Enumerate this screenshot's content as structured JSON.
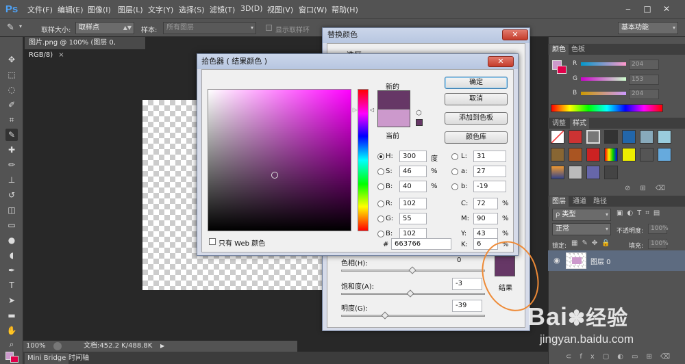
{
  "app": {
    "logo": "Ps"
  },
  "menu": [
    "文件(F)",
    "编辑(E)",
    "图像(I)",
    "图层(L)",
    "文字(Y)",
    "选择(S)",
    "滤镜(T)",
    "3D(D)",
    "视图(V)",
    "窗口(W)",
    "帮助(H)"
  ],
  "window_controls": [
    "‒",
    "□",
    "✕"
  ],
  "options": {
    "sample_size_label": "取样大小:",
    "sample_size_value": "取样点",
    "sample_label": "样本:",
    "sample_value": "所有图层",
    "show_ring_label": "显示取样环",
    "workspace": "基本功能"
  },
  "document": {
    "tab": "图片.png @ 100% (图层 0, RGB/8)",
    "zoom": "100%",
    "doc_info": "文档:452.2 K/488.8K"
  },
  "bottom_tabs": [
    "Mini Bridge",
    "时间轴"
  ],
  "color_panel": {
    "tabs": [
      "颜色",
      "色板"
    ],
    "channels": [
      {
        "label": "R",
        "value": "204"
      },
      {
        "label": "G",
        "value": "153"
      },
      {
        "label": "B",
        "value": "204"
      }
    ],
    "fg_color": "#cc99cc",
    "bg_color": "#e0004a"
  },
  "styles_panel": {
    "tabs": [
      "调整",
      "样式"
    ]
  },
  "layers_panel": {
    "tabs": [
      "图层",
      "通道",
      "路径"
    ],
    "filter_label": "类型",
    "blend_mode": "正常",
    "opacity_label": "不透明度:",
    "opacity_value": "100%",
    "lock_label": "锁定:",
    "fill_label": "填充:",
    "fill_value": "100%",
    "layer_name": "图层 0"
  },
  "replace_dialog": {
    "title": "替换颜色",
    "section": "选区",
    "hue_label": "色相(H):",
    "hue_value": "0",
    "saturation_label": "饱和度(A):",
    "saturation_value": "-3",
    "lightness_label": "明度(G):",
    "lightness_value": "-39",
    "result_label": "结果",
    "result_color": "#663766"
  },
  "picker_dialog": {
    "title": "拾色器 ( 结果颜色 )",
    "new_label": "新的",
    "current_label": "当前",
    "new_color": "#663766",
    "current_color": "#cc99cc",
    "buttons": {
      "ok": "确定",
      "cancel": "取消",
      "add_swatch": "添加到色板",
      "libraries": "颜色库"
    },
    "web_only": "只有 Web 颜色",
    "fields": {
      "H": "300",
      "S": "46",
      "B": "40",
      "R": "102",
      "G": "55",
      "Bv": "102",
      "L": "31",
      "a": "27",
      "b": "-19",
      "C": "72",
      "M": "90",
      "Y": "43",
      "K": "6",
      "hex": "663766"
    },
    "units": {
      "deg": "度",
      "pct": "%"
    }
  },
  "watermark": {
    "brand": "Bai",
    "brand2": "经验",
    "url": "jingyan.baidu.com"
  },
  "accent_colors": {
    "annotation": "#ee8a36",
    "ps_blue": "#4fa3f7"
  }
}
